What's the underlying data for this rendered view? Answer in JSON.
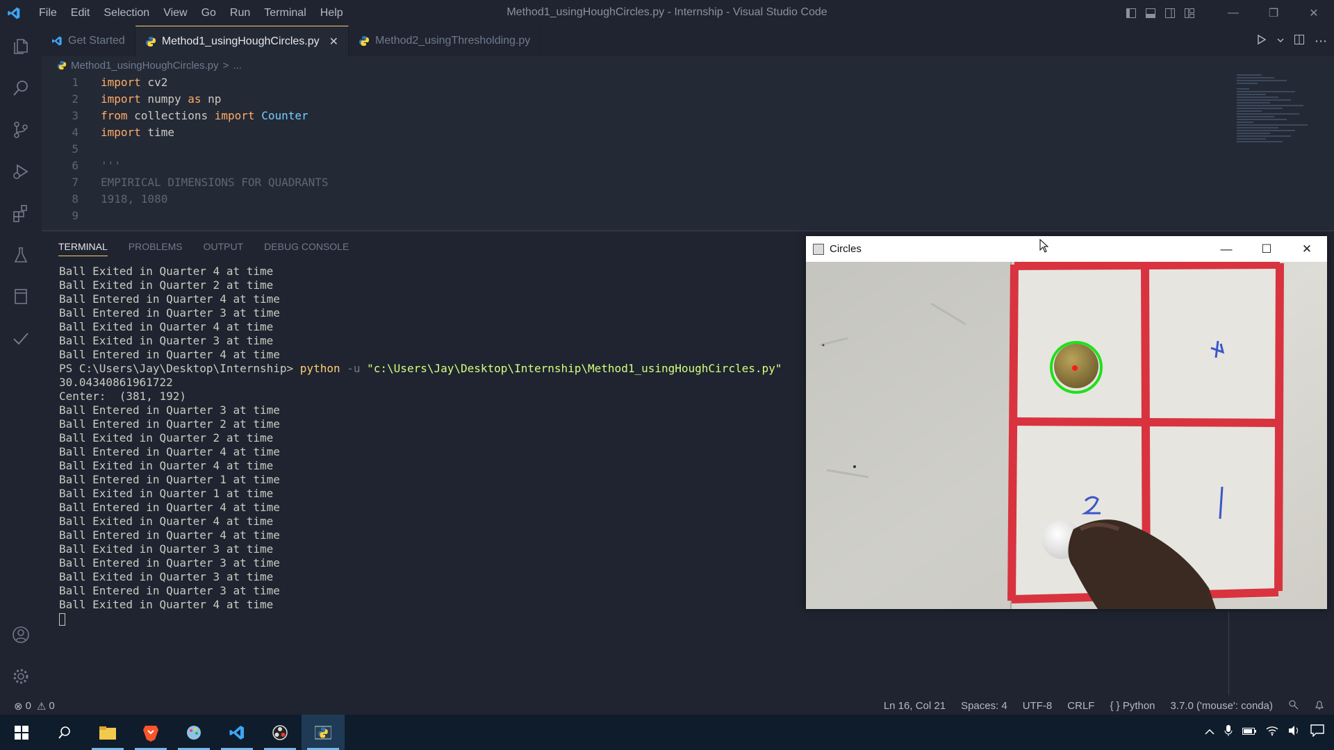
{
  "window": {
    "title": "Method1_usingHoughCircles.py - Internship - Visual Studio Code",
    "menu": [
      "File",
      "Edit",
      "Selection",
      "View",
      "Go",
      "Run",
      "Terminal",
      "Help"
    ]
  },
  "tabs": [
    {
      "label": "Get Started",
      "icon": "vscode-icon",
      "active": false
    },
    {
      "label": "Method1_usingHoughCircles.py",
      "icon": "python-icon",
      "active": true
    },
    {
      "label": "Method2_usingThresholding.py",
      "icon": "python-icon",
      "active": false
    }
  ],
  "breadcrumb": {
    "file": "Method1_usingHoughCircles.py",
    "sep": ">",
    "rest": "..."
  },
  "editor": {
    "lines": [
      {
        "n": "1",
        "k1": "import",
        "t1": " cv2",
        "k2": "",
        "t2": "",
        "c": ""
      },
      {
        "n": "2",
        "k1": "import",
        "t1": " numpy ",
        "k2": "as",
        "t2": " np",
        "c": ""
      },
      {
        "n": "3",
        "k1": "from",
        "t1": " collections ",
        "k2": "import",
        "t2": " ",
        "c": "Counter"
      },
      {
        "n": "4",
        "k1": "import",
        "t1": " time",
        "k2": "",
        "t2": "",
        "c": ""
      },
      {
        "n": "5",
        "k1": "",
        "t1": "",
        "k2": "",
        "t2": "",
        "c": ""
      },
      {
        "n": "6",
        "k1": "",
        "t1": "",
        "k2": "",
        "t2": "",
        "c": "",
        "s": "'''"
      },
      {
        "n": "7",
        "k1": "",
        "t1": "",
        "k2": "",
        "t2": "",
        "c": "",
        "s": "EMPIRICAL DIMENSIONS FOR QUADRANTS"
      },
      {
        "n": "8",
        "k1": "",
        "t1": "",
        "k2": "",
        "t2": "",
        "c": "",
        "s": "1918, 1080"
      },
      {
        "n": "9",
        "k1": "",
        "t1": "",
        "k2": "",
        "t2": "",
        "c": ""
      }
    ]
  },
  "panel": {
    "tabs": [
      "TERMINAL",
      "PROBLEMS",
      "OUTPUT",
      "DEBUG CONSOLE"
    ],
    "prompt": "PS C:\\Users\\Jay\\Desktop\\Internship>",
    "cmd": "python",
    "arg": "-u",
    "path": "\"c:\\Users\\Jay\\Desktop\\Internship\\Method1_usingHoughCircles.py\"",
    "before": [
      "Ball Exited in Quarter 4 at time",
      "Ball Exited in Quarter 2 at time",
      "Ball Entered in Quarter 4 at time",
      "Ball Entered in Quarter 3 at time",
      "Ball Exited in Quarter 4 at time",
      "Ball Exited in Quarter 3 at time",
      "Ball Entered in Quarter 4 at time"
    ],
    "after": [
      "30.04340861961722",
      "Center:  (381, 192)",
      "Ball Entered in Quarter 3 at time",
      "Ball Entered in Quarter 2 at time",
      "Ball Exited in Quarter 2 at time",
      "Ball Entered in Quarter 4 at time",
      "Ball Exited in Quarter 4 at time",
      "Ball Entered in Quarter 1 at time",
      "Ball Exited in Quarter 1 at time",
      "Ball Entered in Quarter 4 at time",
      "Ball Exited in Quarter 4 at time",
      "Ball Entered in Quarter 4 at time",
      "Ball Exited in Quarter 3 at time",
      "Ball Entered in Quarter 3 at time",
      "Ball Exited in Quarter 3 at time",
      "Ball Entered in Quarter 3 at time",
      "Ball Exited in Quarter 4 at time"
    ]
  },
  "circles_window": {
    "title": "Circles",
    "controls": [
      "—",
      "☐",
      "✕"
    ],
    "labels": {
      "q4": "4",
      "q2": "2",
      "q1": "1"
    }
  },
  "statusbar": {
    "errors": "0",
    "warnings": "0",
    "position": "Ln 16, Col 21",
    "spaces": "Spaces: 4",
    "encoding": "UTF-8",
    "eol": "CRLF",
    "language": "Python",
    "interpreter": "3.7.0 ('mouse': conda)"
  },
  "colors": {
    "accent": "#ffcc66",
    "vscode_blue": "#3ea5f5",
    "red_grid": "#d8333f",
    "circle": "#1fe01a"
  }
}
